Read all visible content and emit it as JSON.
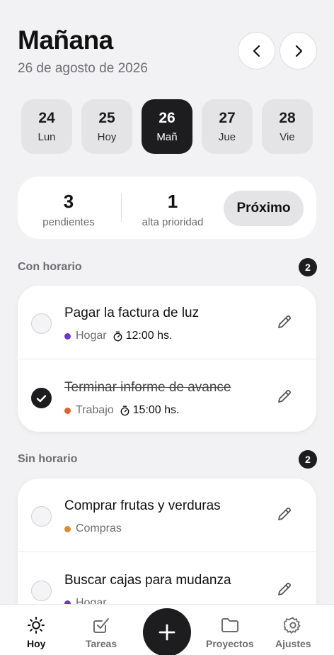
{
  "header": {
    "title": "Mañana",
    "date": "26 de agosto de 2026"
  },
  "days": [
    {
      "num": "24",
      "label": "Lun",
      "active": false
    },
    {
      "num": "25",
      "label": "Hoy",
      "active": false
    },
    {
      "num": "26",
      "label": "Mañ",
      "active": true
    },
    {
      "num": "27",
      "label": "Jue",
      "active": false
    },
    {
      "num": "28",
      "label": "Vie",
      "active": false
    }
  ],
  "summary": {
    "pending_count": "3",
    "pending_label": "pendientes",
    "priority_count": "1",
    "priority_label": "alta prioridad",
    "next_button": "Próximo"
  },
  "sections": {
    "scheduled": {
      "label": "Con horario",
      "count": "2",
      "tasks": [
        {
          "title": "Pagar la factura de luz",
          "category": "Hogar",
          "category_color": "#6e35d6",
          "time": "12:00 hs.",
          "done": false
        },
        {
          "title": "Terminar informe de avance",
          "category": "Trabajo",
          "category_color": "#e0602c",
          "time": "15:00 hs.",
          "done": true
        }
      ]
    },
    "unscheduled": {
      "label": "Sin horario",
      "count": "2",
      "tasks": [
        {
          "title": "Comprar frutas y verduras",
          "category": "Compras",
          "category_color": "#e08a2c",
          "done": false
        },
        {
          "title": "Buscar cajas para mudanza",
          "category": "Hogar",
          "category_color": "#6e35d6",
          "done": false
        }
      ]
    }
  },
  "tabbar": {
    "today": "Hoy",
    "tasks": "Tareas",
    "projects": "Proyectos",
    "settings": "Ajustes"
  },
  "colors": {
    "accent": "#1d1d1f",
    "background": "#f2f2f4"
  }
}
